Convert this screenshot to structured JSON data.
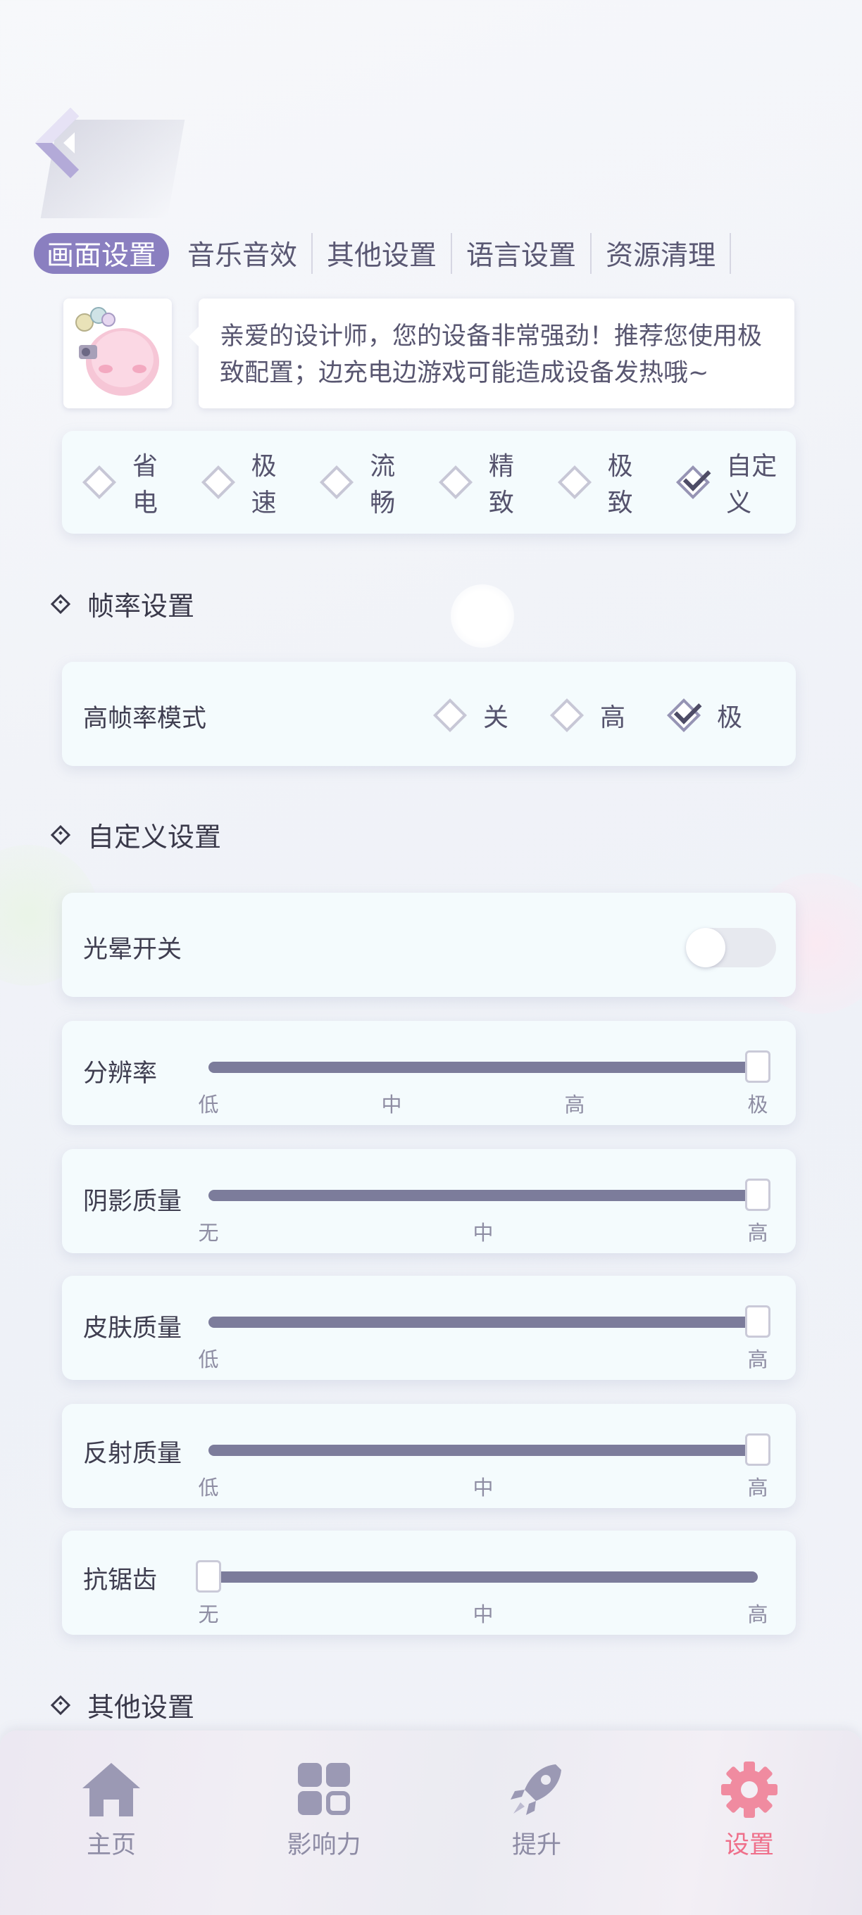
{
  "tabs": [
    "画面设置",
    "音乐音效",
    "其他设置",
    "语言设置",
    "资源清理"
  ],
  "active_tab": 0,
  "tip": {
    "line1": "亲爱的设计师，您的设备非常强劲！推荐您使用极",
    "line2": "致配置；边充电边游戏可能造成设备发热哦~"
  },
  "presets": {
    "options": [
      "省电",
      "极速",
      "流畅",
      "精致",
      "极致",
      "自定义"
    ],
    "selected": "自定义"
  },
  "framerate": {
    "section_title": "帧率设置",
    "label": "高帧率模式",
    "options": [
      "关",
      "高",
      "极"
    ],
    "selected": "极"
  },
  "custom": {
    "section_title": "自定义设置",
    "bloom": {
      "label": "光晕开关",
      "on": false
    },
    "resolution": {
      "label": "分辨率",
      "ticks": [
        "低",
        "中",
        "高",
        "极"
      ],
      "value": 1.0
    },
    "shadow": {
      "label": "阴影质量",
      "ticks": [
        "无",
        "中",
        "高"
      ],
      "value": 1.0
    },
    "skin": {
      "label": "皮肤质量",
      "ticks": [
        "低",
        "高"
      ],
      "value": 1.0
    },
    "reflection": {
      "label": "反射质量",
      "ticks": [
        "低",
        "中",
        "高"
      ],
      "value": 1.0
    },
    "antialias": {
      "label": "抗锯齿",
      "ticks": [
        "无",
        "中",
        "高"
      ],
      "value": 0.0
    }
  },
  "next_section_title": "其他设置",
  "nav": {
    "home": "主页",
    "influence": "影响力",
    "upgrade": "提升",
    "settings": "设置",
    "active": "settings"
  },
  "colors": {
    "accent": "#8a7fc0",
    "slider_track": "#7c7c9b",
    "nav_active": "#ef6f8a",
    "nav_inactive": "#8e8ca5"
  }
}
